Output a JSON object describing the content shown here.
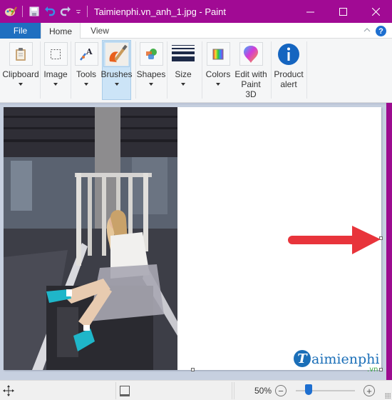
{
  "window": {
    "title": "Taimienphi.vn_anh_1.jpg - Paint",
    "accent_color": "#a10a94",
    "controls": {
      "minimize": "—",
      "maximize": "☐",
      "close": "✕"
    }
  },
  "quick_access": {
    "icons": [
      "paint-app-icon",
      "save-icon",
      "undo-icon",
      "redo-icon",
      "customize-dropdown-icon"
    ]
  },
  "tabs": [
    {
      "label": "File",
      "active": false
    },
    {
      "label": "Home",
      "active": true
    },
    {
      "label": "View",
      "active": false
    }
  ],
  "ribbon": {
    "help_label": "?",
    "collapse_label": "^",
    "groups": [
      {
        "label": "Clipboard",
        "icon": "clipboard-icon",
        "has_dropdown": true
      },
      {
        "label": "Image",
        "icon": "image-select-icon",
        "has_dropdown": true
      },
      {
        "label": "Tools",
        "icon": "tools-icon",
        "has_dropdown": true
      },
      {
        "label": "Brushes",
        "icon": "brushes-icon",
        "has_dropdown": true,
        "active": true
      },
      {
        "label": "Shapes",
        "icon": "shapes-icon",
        "has_dropdown": true
      },
      {
        "label": "Size",
        "icon": "size-icon",
        "has_dropdown": true
      },
      {
        "label": "Colors",
        "icon": "colors-icon",
        "has_dropdown": true
      },
      {
        "label": "Edit with\nPaint 3D",
        "line1": "Edit with",
        "line2": "Paint 3D",
        "icon": "paint3d-icon",
        "has_dropdown": false
      },
      {
        "label": "Product\nalert",
        "line1": "Product",
        "line2": "alert",
        "icon": "info-icon",
        "has_dropdown": false
      }
    ]
  },
  "canvas": {
    "image_description": "Photo of a woman in white shirt and tulle skirt sitting on a wooden pallet in an abandoned building",
    "annotation": "red-arrow-pointing-right",
    "arrow_color": "#e8343b",
    "watermark": {
      "main": "aimienphi",
      "initial": "T",
      "suffix": ".vn"
    }
  },
  "statusbar": {
    "zoom_value": "50%",
    "zoom_percent": 50,
    "zoom_minus": "−",
    "zoom_plus": "+",
    "slider_fraction": 0.22
  }
}
